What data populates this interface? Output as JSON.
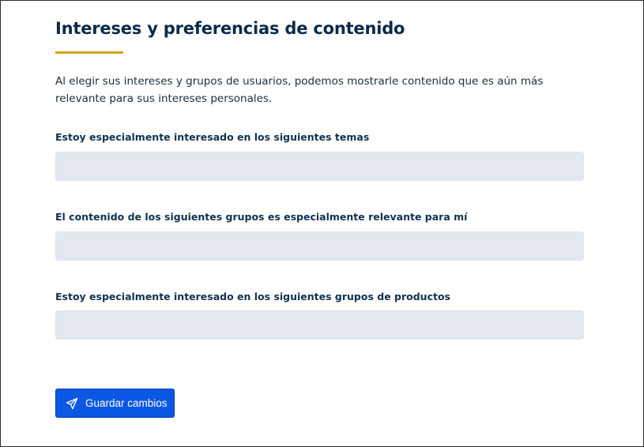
{
  "header": {
    "title": "Intereses y preferencias de contenido",
    "accent_color": "#d6a21a"
  },
  "intro_text": "Al elegir sus intereses y grupos de usuarios, podemos mostrarle contenido que es aún más relevante para sus intereses personales.",
  "fields": [
    {
      "label": "Estoy especialmente interesado en los siguientes temas",
      "value": ""
    },
    {
      "label": "El contenido de los siguientes grupos es especialmente relevante para mí",
      "value": ""
    },
    {
      "label": "Estoy especialmente interesado en los siguientes grupos de productos",
      "value": ""
    }
  ],
  "actions": {
    "save_label": "Guardar cambios",
    "save_icon": "paper-plane-icon",
    "button_color": "#0b58e3"
  }
}
